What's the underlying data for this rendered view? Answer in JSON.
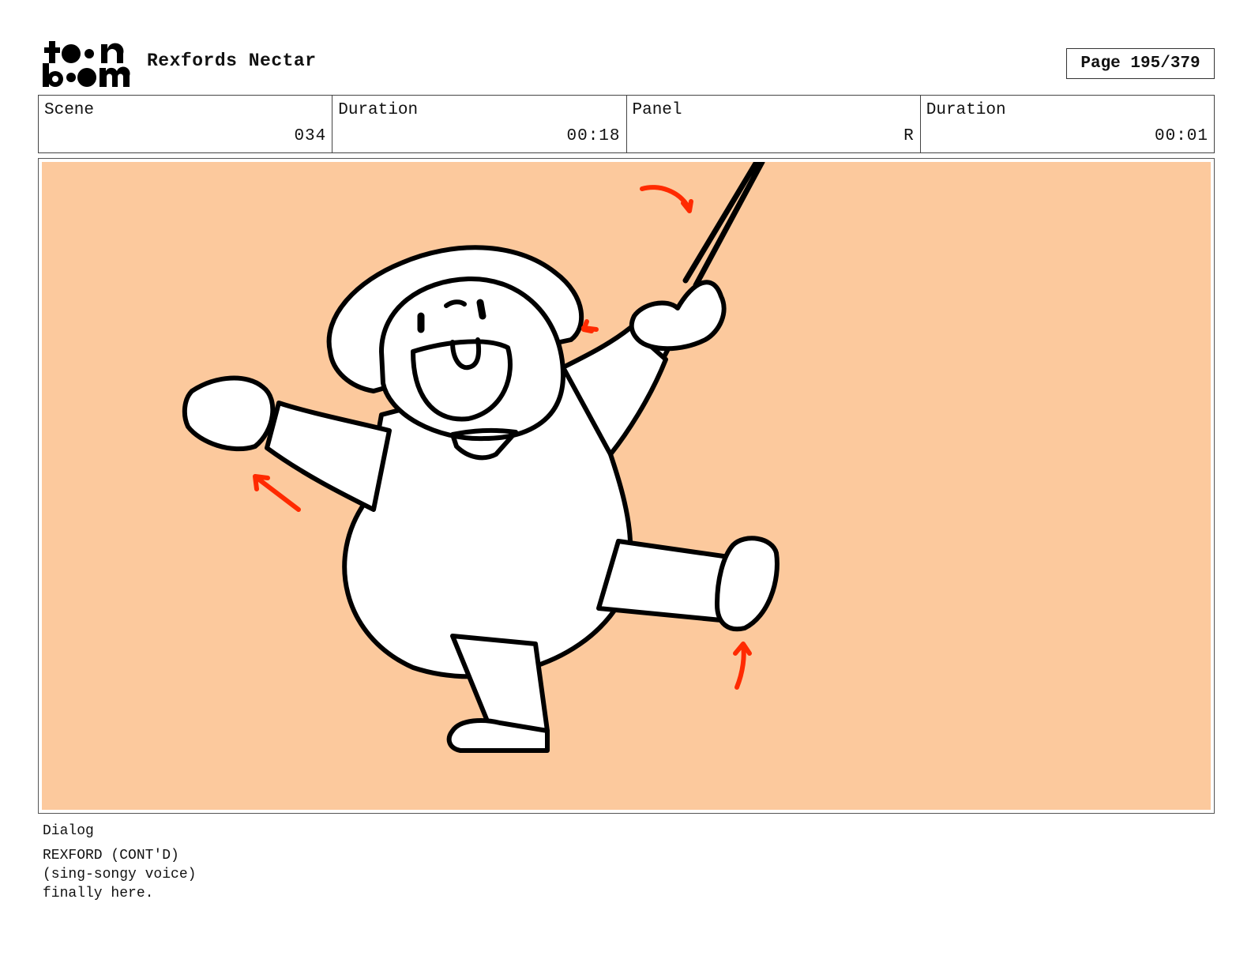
{
  "header": {
    "logo": {
      "line1": "toon",
      "line2": "boom"
    },
    "project_title": "Rexfords Nectar",
    "page": {
      "label": "Page",
      "current": "195",
      "total": "379"
    }
  },
  "info_table": {
    "scene": {
      "label": "Scene",
      "value": "034"
    },
    "scene_duration": {
      "label": "Duration",
      "value": "00:18"
    },
    "panel": {
      "label": "Panel",
      "value": "R"
    },
    "panel_duration": {
      "label": "Duration",
      "value": "00:01"
    }
  },
  "panel": {
    "background_color": "#fcc99d",
    "motion_arrow_color": "#ff2a00",
    "line_color": "#000000",
    "subject": "character-drawing"
  },
  "dialog": {
    "label": "Dialog",
    "character": "REXFORD (CONT'D)",
    "parenthetical": "(sing-songy voice)",
    "line": "finally here."
  }
}
